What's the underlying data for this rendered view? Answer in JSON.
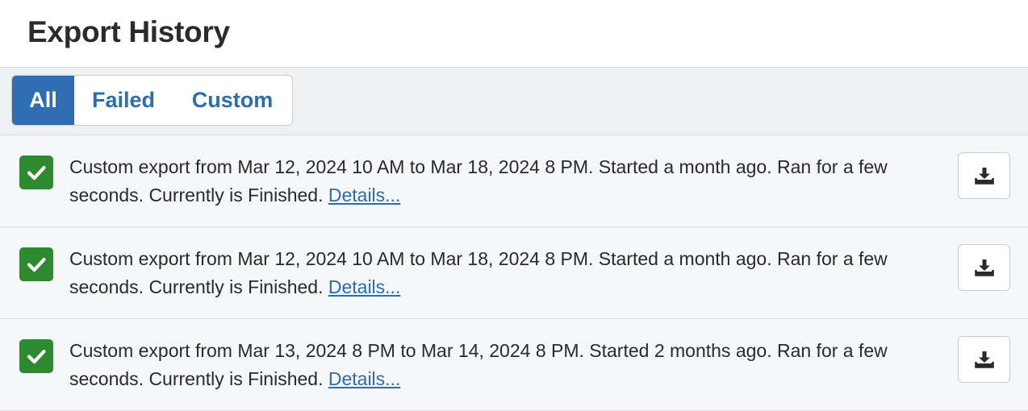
{
  "header": {
    "title": "Export History"
  },
  "filters": {
    "tabs": [
      {
        "label": "All",
        "active": true
      },
      {
        "label": "Failed",
        "active": false
      },
      {
        "label": "Custom",
        "active": false
      }
    ]
  },
  "exports": [
    {
      "status": "success",
      "description": "Custom export from Mar 12, 2024 10 AM to Mar 18, 2024 8 PM. Started a month ago. Ran for a few seconds. Currently is Finished.",
      "details_label": "Details..."
    },
    {
      "status": "success",
      "description": "Custom export from Mar 12, 2024 10 AM to Mar 18, 2024 8 PM. Started a month ago. Ran for a few seconds. Currently is Finished.",
      "details_label": "Details..."
    },
    {
      "status": "success",
      "description": "Custom export from Mar 13, 2024 8 PM to Mar 14, 2024 8 PM. Started 2 months ago. Ran for a few seconds. Currently is Finished.",
      "details_label": "Details..."
    }
  ],
  "icons": {
    "status": "checkmark-icon",
    "download": "download-icon"
  },
  "colors": {
    "accent": "#2f6db3",
    "success": "#2e8a2e",
    "link": "#2c6cb0"
  }
}
